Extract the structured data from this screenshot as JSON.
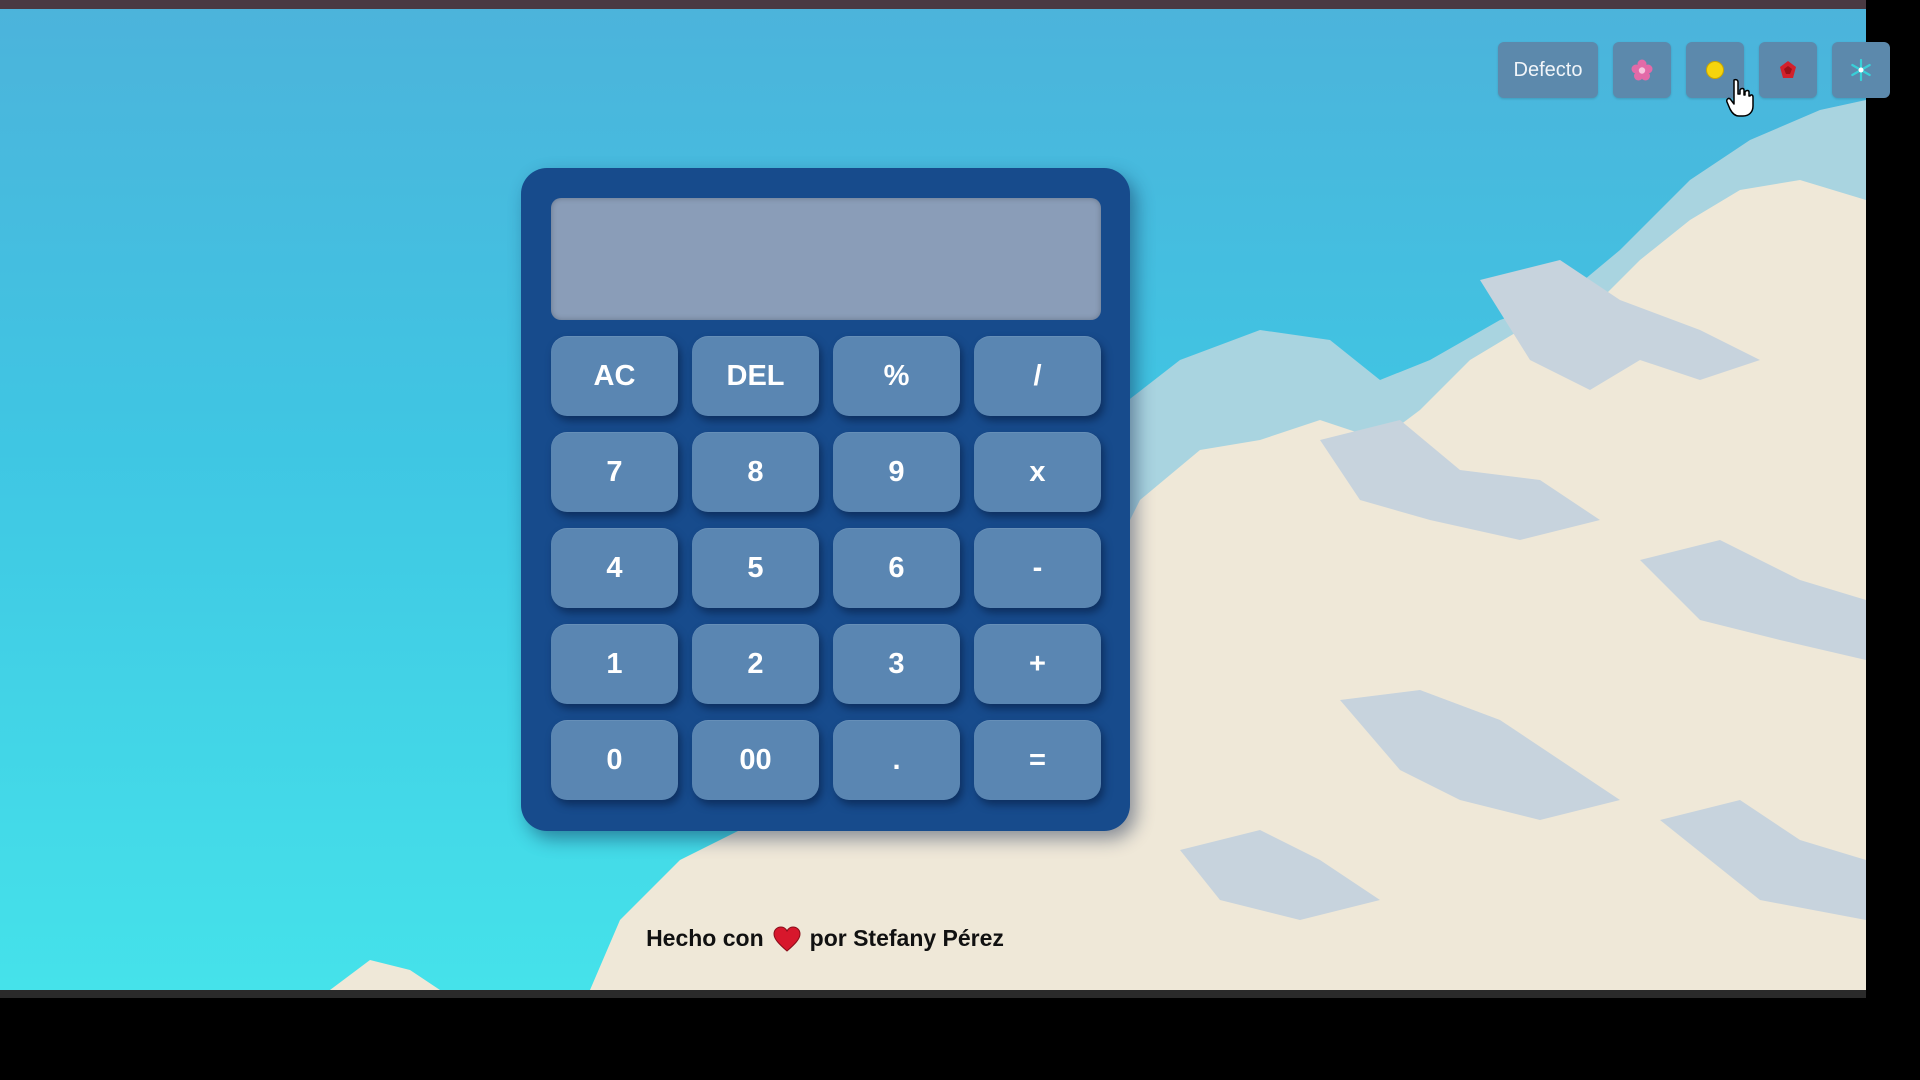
{
  "themes": {
    "default_label": "Defecto",
    "items": [
      {
        "name": "flower-icon",
        "color": "#e36aa8"
      },
      {
        "name": "sun-icon",
        "color": "#f5d40c"
      },
      {
        "name": "rose-icon",
        "color": "#d3202b"
      },
      {
        "name": "snowflake-icon",
        "color": "#39d0d8"
      }
    ]
  },
  "calculator": {
    "display_value": "",
    "keys": [
      [
        "AC",
        "DEL",
        "%",
        "/"
      ],
      [
        "7",
        "8",
        "9",
        "x"
      ],
      [
        "4",
        "5",
        "6",
        "-"
      ],
      [
        "1",
        "2",
        "3",
        "+"
      ],
      [
        "0",
        "00",
        ".",
        "="
      ]
    ]
  },
  "footer": {
    "prefix": "Hecho con",
    "heart_icon": "heart-icon",
    "suffix": "por Stefany Pérez"
  },
  "colors": {
    "calculator_body": "#174b8c",
    "key": "#5a86b2",
    "display": "#8a9db8",
    "theme_button": "#5c89ac"
  }
}
